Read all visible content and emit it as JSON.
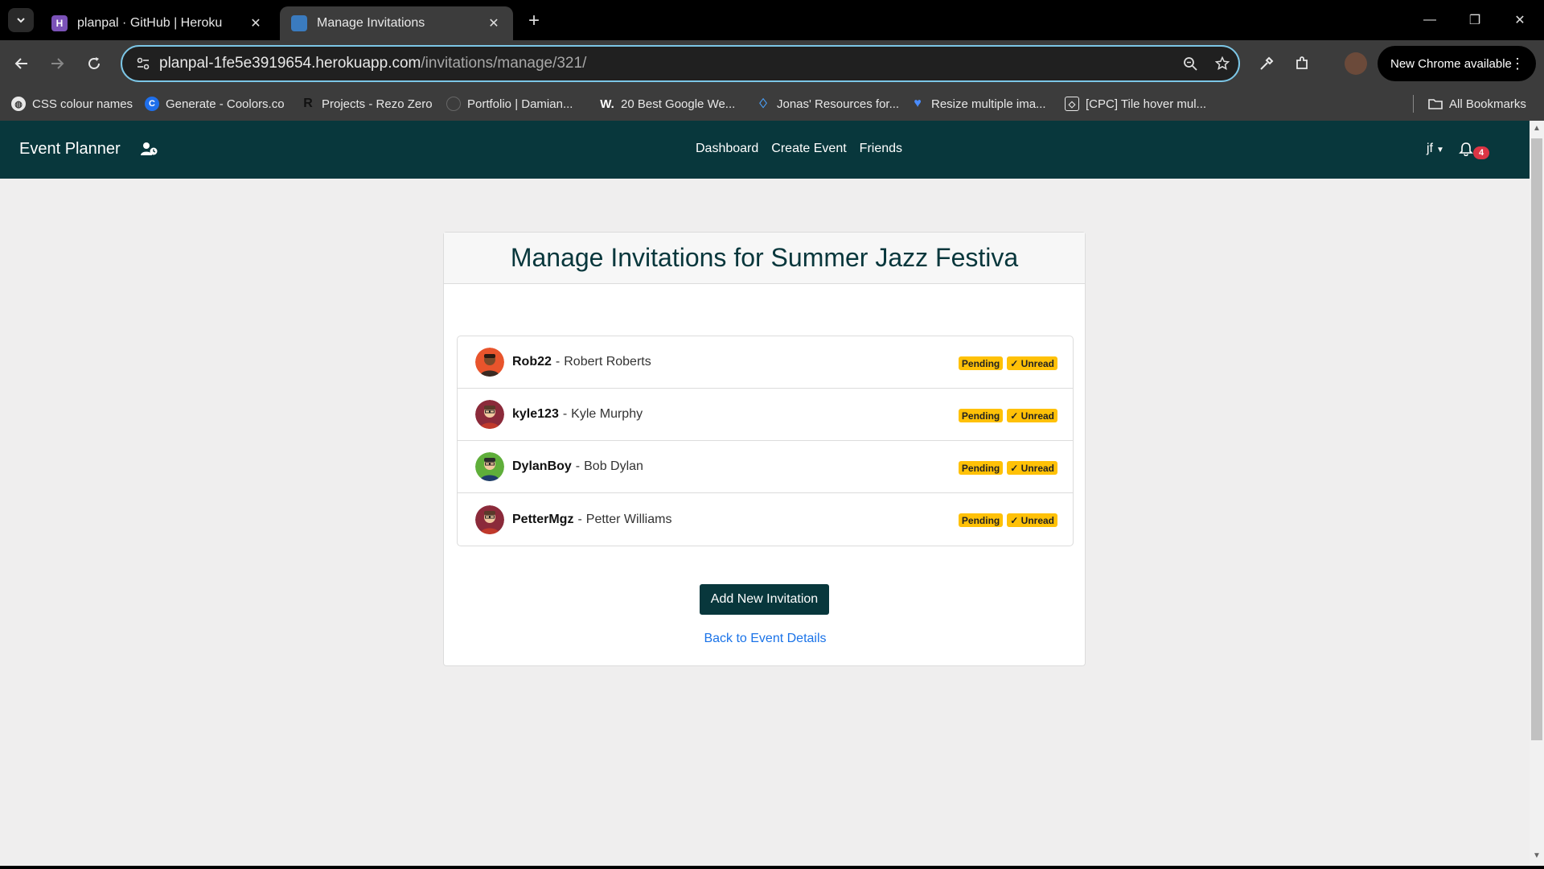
{
  "browser": {
    "tabs": [
      {
        "title": "planpal · GitHub | Heroku",
        "favicon": "heroku-icon",
        "active": false
      },
      {
        "title": "Manage Invitations",
        "favicon": "site-favicon",
        "active": true
      }
    ],
    "url_host": "planpal-1fe5e3919654.herokuapp.com",
    "url_path": "/invitations/manage/321/",
    "update_button": "New Chrome available",
    "bookmarks": [
      {
        "label": "CSS colour names",
        "icon": "globe-icon"
      },
      {
        "label": "Generate - Coolors.co",
        "icon": "coolors-icon"
      },
      {
        "label": "Projects - Rezo Zero",
        "icon": "rezo-icon"
      },
      {
        "label": "Portfolio | Damian...",
        "icon": "portfolio-icon"
      },
      {
        "label": "20 Best Google We...",
        "icon": "w-icon"
      },
      {
        "label": "Jonas' Resources for...",
        "icon": "diamond-icon"
      },
      {
        "label": "Resize multiple ima...",
        "icon": "heart-icon"
      },
      {
        "label": "[CPC] Tile hover mul...",
        "icon": "codepen-icon"
      }
    ],
    "all_bookmarks": "All Bookmarks"
  },
  "app": {
    "brand": "Event Planner",
    "nav": [
      "Dashboard",
      "Create Event",
      "Friends"
    ],
    "user": "jf",
    "notifications": "4"
  },
  "page": {
    "title": "Manage Invitations for Summer Jazz Festiva",
    "invitations": [
      {
        "username": "Rob22",
        "name": "Robert Roberts",
        "status": "Pending",
        "read": "✓ Unread",
        "avatar_color": "#e8542c"
      },
      {
        "username": "kyle123",
        "name": "Kyle Murphy",
        "status": "Pending",
        "read": "✓ Unread",
        "avatar_color": "#8b2a3a"
      },
      {
        "username": "DylanBoy",
        "name": "Bob Dylan",
        "status": "Pending",
        "read": "✓ Unread",
        "avatar_color": "#5fae3a"
      },
      {
        "username": "PetterMgz",
        "name": "Petter Williams",
        "status": "Pending",
        "read": "✓ Unread",
        "avatar_color": "#8b2a3a"
      }
    ],
    "add_button": "Add New Invitation",
    "back_link": "Back to Event Details"
  }
}
